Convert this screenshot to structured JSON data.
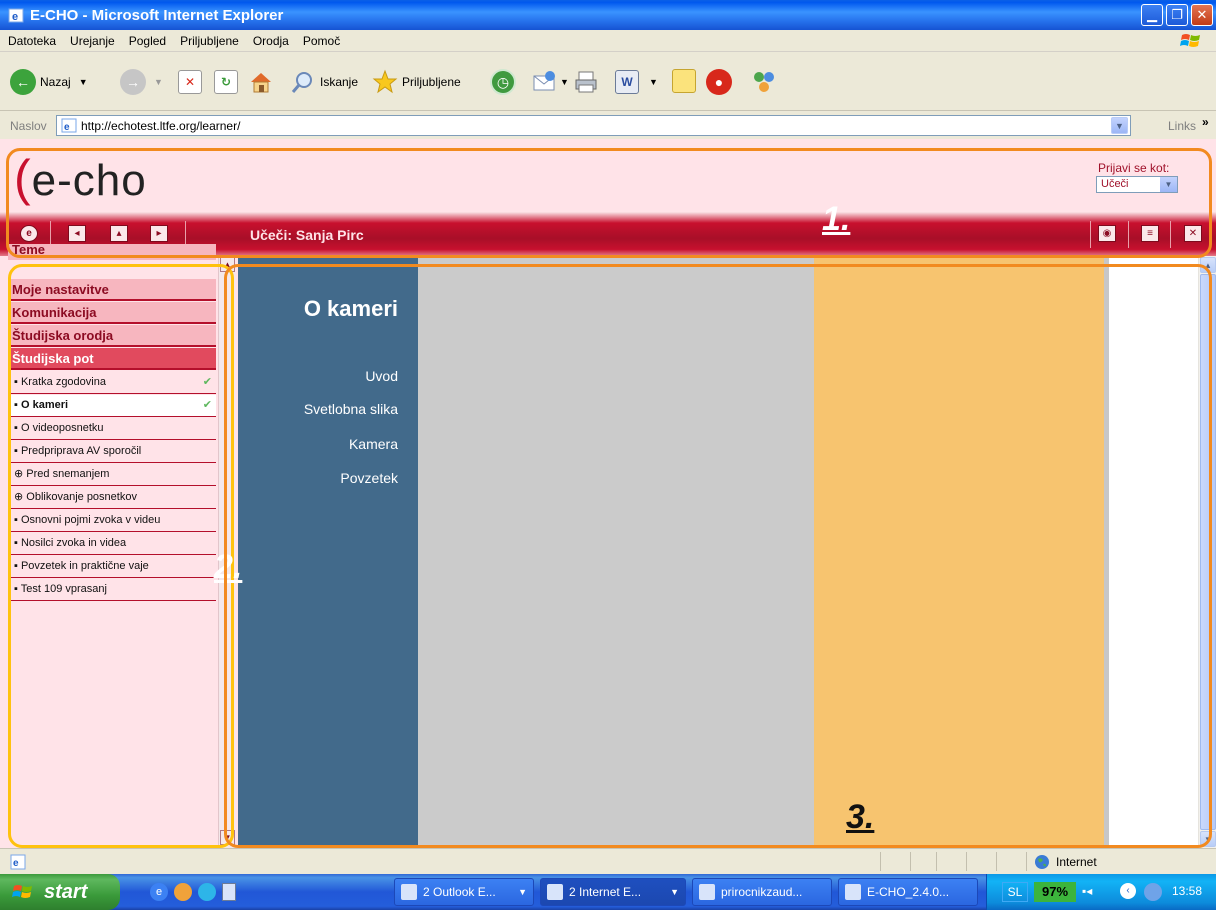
{
  "window": {
    "title": "E-CHO - Microsoft Internet Explorer"
  },
  "menu": [
    "Datoteka",
    "Urejanje",
    "Pogled",
    "Priljubljene",
    "Orodja",
    "Pomoč"
  ],
  "toolbar": {
    "back": "Nazaj",
    "search": "Iskanje",
    "favorites": "Priljubljene"
  },
  "address": {
    "label": "Naslov",
    "url": "http://echotest.ltfe.org/learner/",
    "links": "Links"
  },
  "echo": {
    "logo_paren": "(",
    "logo_e": "e",
    "logo_rest": "-cho",
    "role_label": "Prijavi se kot:",
    "role_value": "Učeči",
    "user": "Učeči: Sanja Pirc"
  },
  "sidebar": {
    "top_cut": "Teme",
    "sections": [
      {
        "label": "Moje nastavitve"
      },
      {
        "label": "Komunikacija"
      },
      {
        "label": "Študijska orodja"
      },
      {
        "label": "Študijska pot"
      }
    ],
    "items": [
      {
        "label": "Kratka zgodovina",
        "done": true
      },
      {
        "label": "O kameri",
        "done": true
      },
      {
        "label": "O videoposnetku",
        "done": false
      },
      {
        "label": "Predpriprava AV sporočil",
        "done": false
      },
      {
        "label": "Pred snemanjem",
        "done": false
      },
      {
        "label": "Oblikovanje posnetkov",
        "done": false
      },
      {
        "label": "Osnovni pojmi zvoka v videu",
        "done": false
      },
      {
        "label": "Nosilci zvoka in videa",
        "done": false
      },
      {
        "label": "Povzetek in praktične vaje",
        "done": false
      },
      {
        "label": "Test 109 vprasanj",
        "done": false
      }
    ],
    "bullets": {
      "plain": "▪",
      "plus": "⊕",
      "check": "✔"
    }
  },
  "main": {
    "title": "O kameri",
    "links": [
      "Uvod",
      "Svetlobna slika",
      "Kamera",
      "Povzetek"
    ]
  },
  "annotations": [
    "1.",
    "2.",
    "3."
  ],
  "status": {
    "zone": "Internet"
  },
  "taskbar": {
    "start": "start",
    "tasks": [
      "2 Outlook E...",
      "2 Internet E...",
      "prirocnikzaud...",
      "E-CHO_2.4.0..."
    ],
    "lang": "SL",
    "battery": "97%",
    "clock": "13:58"
  },
  "colors": {
    "accent": "#C8102E",
    "header_bg": "#FFE3E8",
    "blue_panel": "#426A8B",
    "orange_panel": "#F7C46F",
    "annotation_orange": "#F28A1F",
    "annotation_yellow": "#FFC20E"
  }
}
